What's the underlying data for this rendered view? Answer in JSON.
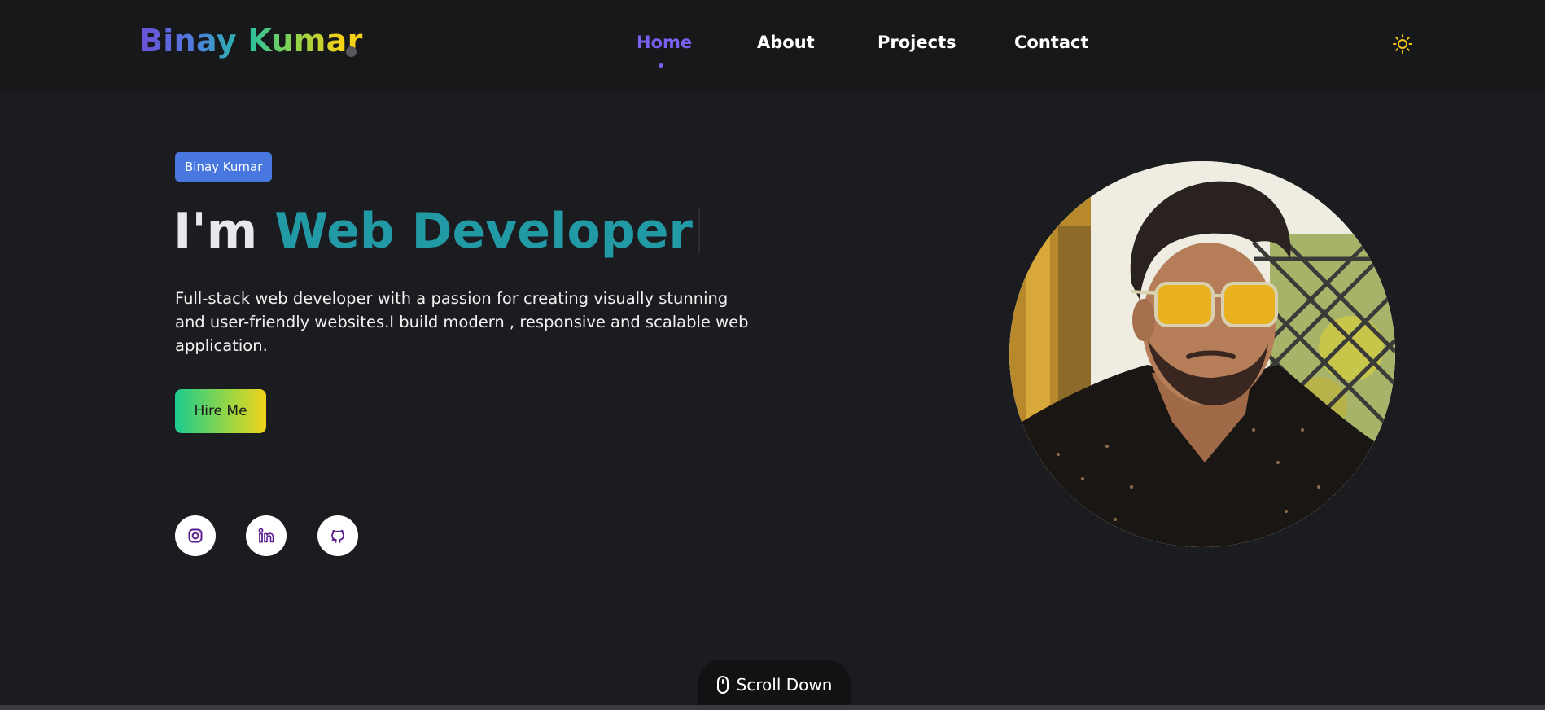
{
  "header": {
    "logo": "Binay Kumar",
    "nav": [
      {
        "label": "Home",
        "active": true
      },
      {
        "label": "About",
        "active": false
      },
      {
        "label": "Projects",
        "active": false
      },
      {
        "label": "Contact",
        "active": false
      }
    ],
    "theme_toggle_icon": "sun-icon"
  },
  "hero": {
    "badge": "Binay Kumar",
    "headline_prefix": "I'm",
    "headline_role": "Web Developer",
    "description": "Full-stack web developer with a passion for creating visually stunning and user-friendly websites.I build modern , responsive and scalable web application.",
    "cta_label": "Hire Me",
    "socials": [
      {
        "icon": "instagram-icon"
      },
      {
        "icon": "linkedin-icon"
      },
      {
        "icon": "github-icon"
      }
    ]
  },
  "scroll": {
    "label": "Scroll Down",
    "icon": "mouse-icon"
  },
  "colors": {
    "background": "#1b1c1f",
    "navbar": "#17181a",
    "accent_purple": "#7a5ff0",
    "role_teal": "#219aa6",
    "badge_blue": "#4877e0",
    "sun_yellow": "#f3c316"
  }
}
